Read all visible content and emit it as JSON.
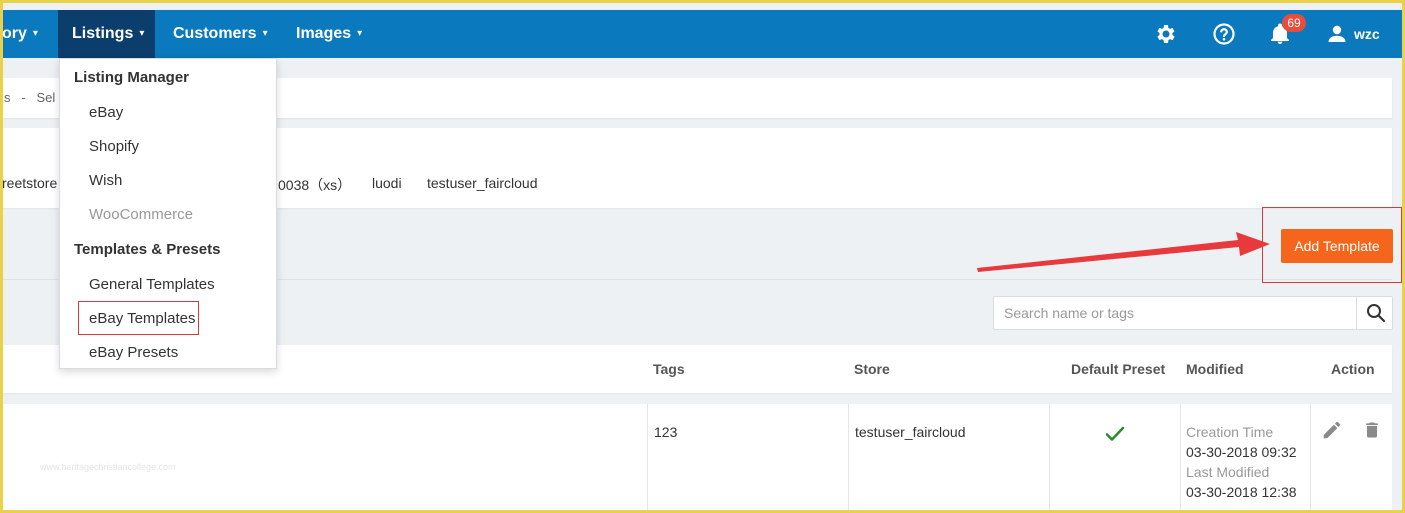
{
  "nav": {
    "items": [
      {
        "label": "ory",
        "caret": "▾"
      },
      {
        "label": "Listings",
        "caret": "▾"
      },
      {
        "label": "Customers",
        "caret": "▾"
      },
      {
        "label": "Images",
        "caret": "▾"
      }
    ],
    "notification_count": "69",
    "user_name": "wzc"
  },
  "breadcrumb": {
    "text": "s   -   Sel"
  },
  "stores": [
    "reetstore",
    "0038（xs）",
    "luodi",
    "testuser_faircloud"
  ],
  "dropdown": {
    "listing_manager": "Listing Manager",
    "listing_items": [
      "eBay",
      "Shopify",
      "Wish",
      "WooCommerce"
    ],
    "templates_presets": "Templates & Presets",
    "template_items": [
      "General Templates",
      "eBay Templates",
      "eBay Presets"
    ]
  },
  "toolbar": {
    "add_template": "Add Template"
  },
  "search": {
    "placeholder": "Search name or tags"
  },
  "table": {
    "headers": {
      "tags": "Tags",
      "store": "Store",
      "default_preset": "Default Preset",
      "modified": "Modified",
      "action": "Action"
    },
    "rows": [
      {
        "tags": "123",
        "store": "testuser_faircloud",
        "default_preset": "✓",
        "creation_label": "Creation Time",
        "creation_time": "03-30-2018 09:32",
        "modified_label": "Last Modified",
        "modified_time": "03-30-2018 12:38"
      }
    ]
  },
  "watermark": "www.heritagechristiancollege.com",
  "colors": {
    "nav_bg": "#0a79bd",
    "nav_active": "#0b3e6d",
    "accent": "#f5661c",
    "annotation": "#e8393d",
    "check": "#2e8b2e"
  },
  "icons": [
    "gear-icon",
    "help-icon",
    "bell-icon",
    "user-icon",
    "search-icon",
    "check-icon",
    "edit-icon",
    "trash-icon"
  ]
}
